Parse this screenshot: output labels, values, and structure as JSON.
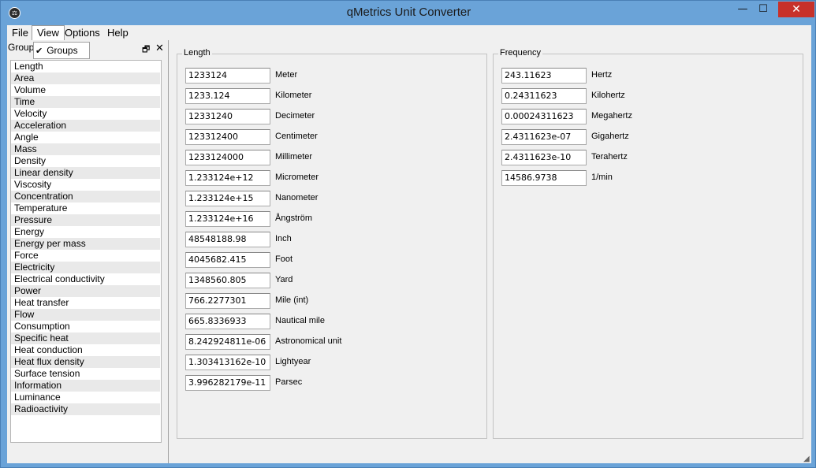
{
  "window": {
    "title": "qMetrics Unit Converter",
    "minimize": "—",
    "maximize": "☐",
    "close": "✕"
  },
  "menu": [
    "File",
    "View",
    "Options",
    "Help"
  ],
  "dock": {
    "label": "Group",
    "groups_check": "✔",
    "groups_label": "Groups",
    "float_icon": "🗗",
    "close_icon": "✕"
  },
  "groups": [
    "Length",
    "Area",
    "Volume",
    "Time",
    "Velocity",
    "Acceleration",
    "Angle",
    "Mass",
    "Density",
    "Linear density",
    "Viscosity",
    "Concentration",
    "Temperature",
    "Pressure",
    "Energy",
    "Energy per mass",
    "Force",
    "Electricity",
    "Electrical conductivity",
    "Power",
    "Heat transfer",
    "Flow",
    "Consumption",
    "Specific heat",
    "Heat conduction",
    "Heat flux density",
    "Surface tension",
    "Information",
    "Luminance",
    "Radioactivity"
  ],
  "length": {
    "title": "Length",
    "rows": [
      {
        "value": "1233124",
        "unit": "Meter"
      },
      {
        "value": "1233.124",
        "unit": "Kilometer"
      },
      {
        "value": "12331240",
        "unit": "Decimeter"
      },
      {
        "value": "123312400",
        "unit": "Centimeter"
      },
      {
        "value": "1233124000",
        "unit": "Millimeter"
      },
      {
        "value": "1.233124e+12",
        "unit": "Micrometer"
      },
      {
        "value": "1.233124e+15",
        "unit": "Nanometer"
      },
      {
        "value": "1.233124e+16",
        "unit": "Ångström"
      },
      {
        "value": "48548188.98",
        "unit": "Inch"
      },
      {
        "value": "4045682.415",
        "unit": "Foot"
      },
      {
        "value": "1348560.805",
        "unit": "Yard"
      },
      {
        "value": "766.2277301",
        "unit": "Mile (int)"
      },
      {
        "value": "665.8336933",
        "unit": "Nautical mile"
      },
      {
        "value": "8.242924811e-06",
        "unit": "Astronomical unit"
      },
      {
        "value": "1.303413162e-10",
        "unit": "Lightyear"
      },
      {
        "value": "3.996282179e-11",
        "unit": "Parsec"
      }
    ]
  },
  "frequency": {
    "title": "Frequency",
    "rows": [
      {
        "value": "243.11623",
        "unit": "Hertz"
      },
      {
        "value": "0.24311623",
        "unit": "Kilohertz"
      },
      {
        "value": "0.00024311623",
        "unit": "Megahertz"
      },
      {
        "value": "2.4311623e-07",
        "unit": "Gigahertz"
      },
      {
        "value": "2.4311623e-10",
        "unit": "Terahertz"
      },
      {
        "value": "14586.9738",
        "unit": "1/min"
      }
    ]
  }
}
